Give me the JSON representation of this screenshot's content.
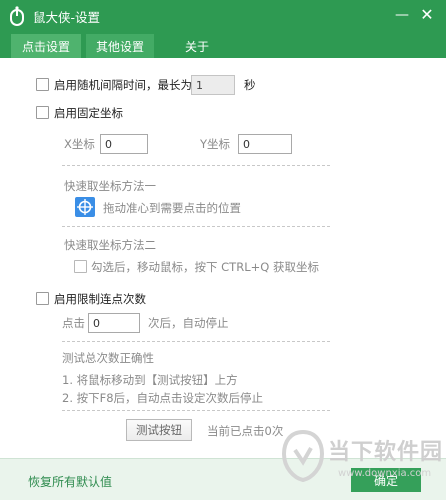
{
  "window": {
    "title": "鼠大侠-设置",
    "minimize_glyph": "—",
    "close_glyph": "✕"
  },
  "tabs": [
    {
      "label": "点击设置",
      "active": true
    },
    {
      "label": "其他设置",
      "active": false
    },
    {
      "label": "关于",
      "active": false
    }
  ],
  "random_interval": {
    "label": "启用随机间隔时间，最长为",
    "value": "1",
    "unit": "秒",
    "checked": false
  },
  "fixed_coords": {
    "label": "启用固定坐标",
    "checked": false,
    "x_label": "X坐标",
    "x_value": "0",
    "y_label": "Y坐标",
    "y_value": "0",
    "method1_title": "快速取坐标方法一",
    "method1_desc": "拖动准心到需要点击的位置",
    "method2_title": "快速取坐标方法二",
    "method2_desc": "勾选后，移动鼠标，按下 CTRL+Q 获取坐标",
    "method2_checked": false
  },
  "limit_clicks": {
    "label": "启用限制连点次数",
    "checked": false,
    "prefix": "点击",
    "value": "0",
    "suffix": "次后，自动停止"
  },
  "test": {
    "title": "测试总次数正确性",
    "step1": "1. 将鼠标移动到【测试按钮】上方",
    "step2": "2. 按下F8后，自动点击设定次数后停止",
    "button_label": "测试按钮",
    "status": "当前已点击0次"
  },
  "footer": {
    "reset_label": "恢复所有默认值",
    "ok_label": "确定"
  },
  "watermark": {
    "text": "当下软件园",
    "url": "www.downxia.com"
  },
  "colors": {
    "brand_green": "#2e9a52",
    "active_tab": "#4fb36e",
    "crosshair_blue": "#3a8ee6"
  }
}
